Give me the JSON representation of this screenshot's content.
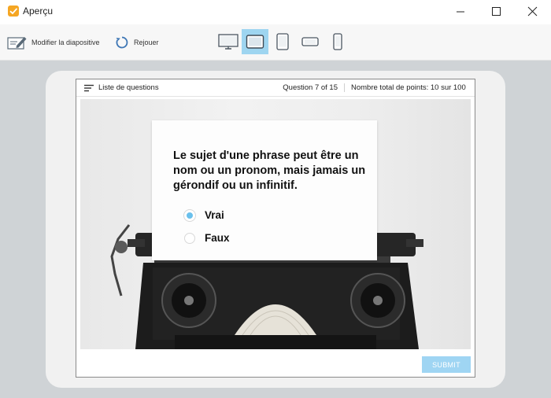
{
  "window": {
    "title": "Aperçu"
  },
  "toolbar": {
    "edit_label": "Modifier la diapositive",
    "replay_label": "Rejouer",
    "devices": [
      "desktop",
      "tablet-landscape",
      "tablet-portrait",
      "phone-landscape",
      "phone-portrait"
    ],
    "active_device": "tablet-landscape"
  },
  "quiz": {
    "list_label": "Liste de questions",
    "progress": "Question 7 of 15",
    "points": "Nombre total de points: 10 sur 100",
    "question": "Le sujet d'une phrase peut être un nom ou un pronom, mais jamais un gérondif ou un infinitif.",
    "options": [
      {
        "label": "Vrai",
        "selected": true
      },
      {
        "label": "Faux",
        "selected": false
      }
    ],
    "submit_label": "SUBMIT"
  },
  "colors": {
    "accent": "#9ed5f0",
    "submit": "#9fd5f3",
    "radio_selected": "#6ac0ec",
    "app_icon": "#f5a623"
  }
}
